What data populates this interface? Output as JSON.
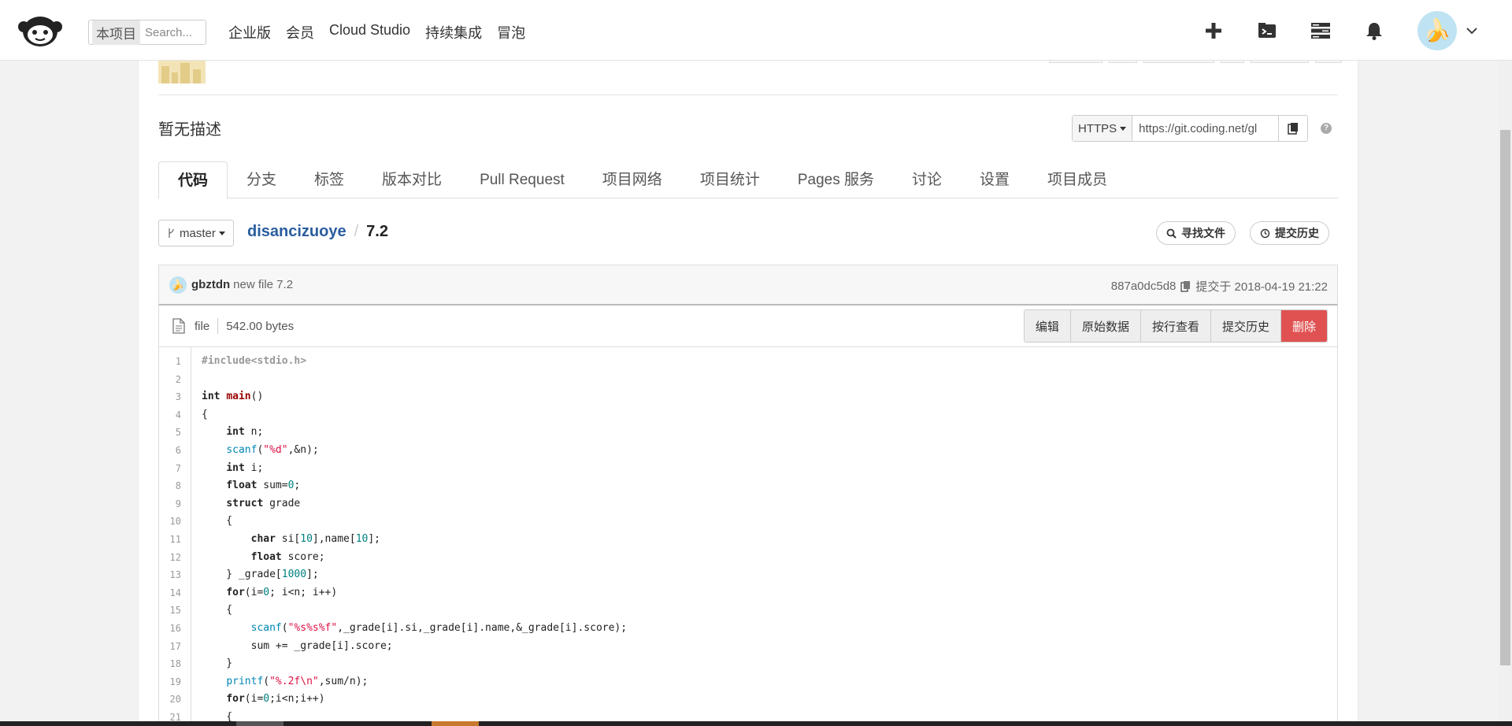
{
  "topnav": {
    "search_scope": "本项目",
    "search_placeholder": "Search...",
    "links": [
      "企业版",
      "会员",
      "Cloud Studio",
      "持续集成",
      "冒泡"
    ]
  },
  "repo": {
    "description": "暂无描述",
    "clone_protocol": "HTTPS",
    "clone_url": "https://git.coding.net/gl"
  },
  "tabs": [
    "代码",
    "分支",
    "标签",
    "版本对比",
    "Pull Request",
    "项目网络",
    "项目统计",
    "Pages 服务",
    "讨论",
    "设置",
    "项目成员"
  ],
  "branch": "master",
  "breadcrumb": {
    "repo": "disancizuoye",
    "separator": "/",
    "file": "7.2"
  },
  "file_actions": {
    "find_file": "寻找文件",
    "history": "提交历史"
  },
  "commit": {
    "author": "gbztdn",
    "message": "new file 7.2",
    "hash": "887a0dc5d8",
    "date_text": "提交于 2018-04-19 21:22"
  },
  "fileinfo": {
    "type": "file",
    "size": "542.00 bytes"
  },
  "buttons": {
    "edit": "编辑",
    "raw": "原始数据",
    "blame": "按行查看",
    "history": "提交历史",
    "delete": "删除"
  },
  "code_lines": [
    "#include<stdio.h>",
    "",
    "int main()",
    "{",
    "    int n;",
    "    scanf(\"%d\",&n);",
    "    int i;",
    "    float sum=0;",
    "    struct grade",
    "    {",
    "        char si[10],name[10];",
    "        float score;",
    "    } _grade[1000];",
    "    for(i=0; i<n; i++)",
    "    {",
    "        scanf(\"%s%s%f\",_grade[i].si,_grade[i].name,&_grade[i].score);",
    "        sum += _grade[i].score;",
    "    }",
    "    printf(\"%.2f\\n\",sum/n);",
    "    for(i=0;i<n;i++)",
    "    {"
  ],
  "line_numbers": [
    "1",
    "2",
    "3",
    "4",
    "5",
    "6",
    "7",
    "8",
    "9",
    "10",
    "11",
    "12",
    "13",
    "14",
    "15",
    "16",
    "17",
    "18",
    "19",
    "20",
    "21"
  ]
}
